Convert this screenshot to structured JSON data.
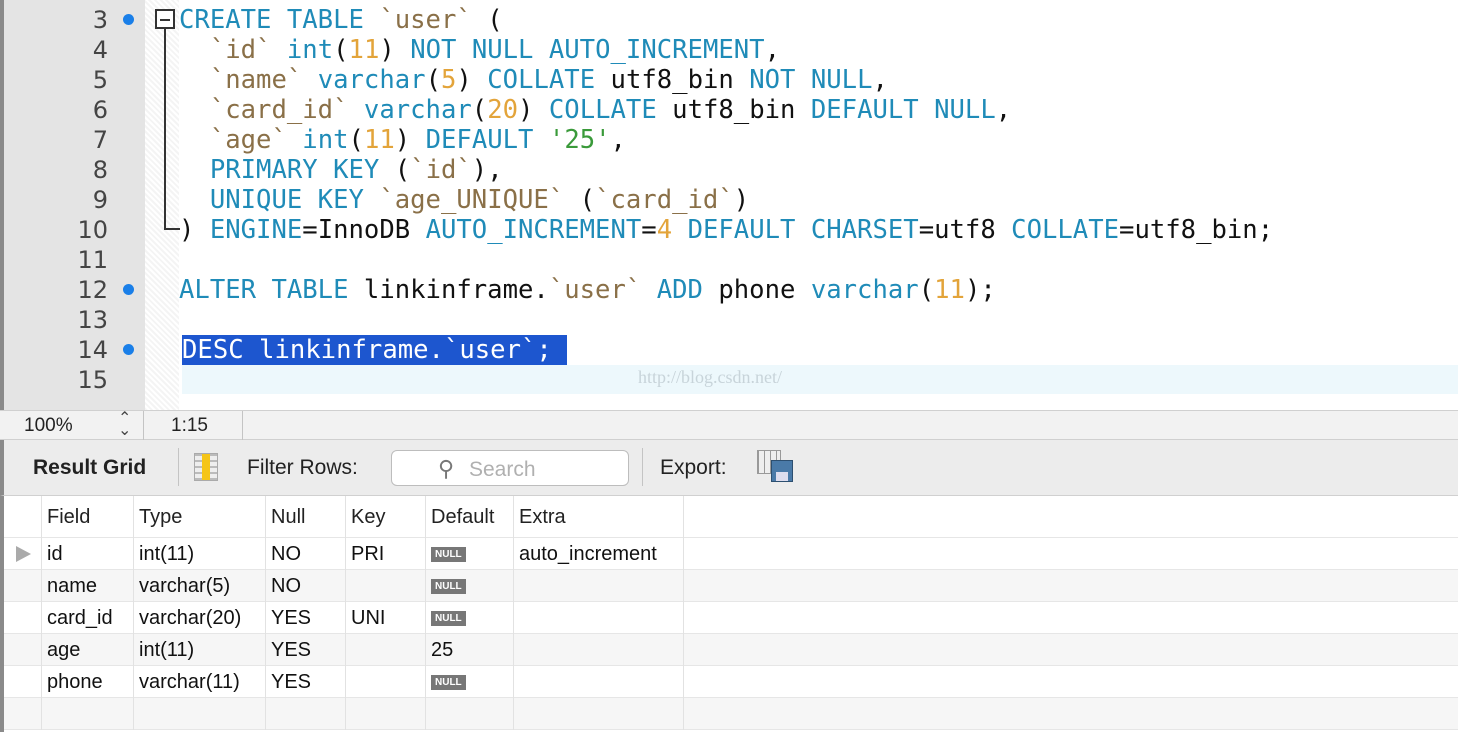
{
  "editor": {
    "lines": [
      {
        "n": "3",
        "dot": true,
        "tokens": [
          [
            "kw",
            "CREATE TABLE "
          ],
          [
            "id",
            "`user`"
          ],
          [
            "pl",
            " ("
          ]
        ]
      },
      {
        "n": "4",
        "dot": false,
        "tokens": [
          [
            "id",
            "  `id`"
          ],
          [
            "pl",
            " "
          ],
          [
            "kw",
            "int"
          ],
          [
            "pl",
            "("
          ],
          [
            "num",
            "11"
          ],
          [
            "pl",
            ") "
          ],
          [
            "kw",
            "NOT NULL AUTO_INCREMENT"
          ],
          [
            "pl",
            ","
          ]
        ]
      },
      {
        "n": "5",
        "dot": false,
        "tokens": [
          [
            "id",
            "  `name`"
          ],
          [
            "pl",
            " "
          ],
          [
            "kw",
            "varchar"
          ],
          [
            "pl",
            "("
          ],
          [
            "num",
            "5"
          ],
          [
            "pl",
            ") "
          ],
          [
            "kw",
            "COLLATE"
          ],
          [
            "pl",
            " utf8_bin "
          ],
          [
            "kw",
            "NOT NULL"
          ],
          [
            "pl",
            ","
          ]
        ]
      },
      {
        "n": "6",
        "dot": false,
        "tokens": [
          [
            "id",
            "  `card_id`"
          ],
          [
            "pl",
            " "
          ],
          [
            "kw",
            "varchar"
          ],
          [
            "pl",
            "("
          ],
          [
            "num",
            "20"
          ],
          [
            "pl",
            ") "
          ],
          [
            "kw",
            "COLLATE"
          ],
          [
            "pl",
            " utf8_bin "
          ],
          [
            "kw",
            "DEFAULT NULL"
          ],
          [
            "pl",
            ","
          ]
        ]
      },
      {
        "n": "7",
        "dot": false,
        "tokens": [
          [
            "id",
            "  `age`"
          ],
          [
            "pl",
            " "
          ],
          [
            "kw",
            "int"
          ],
          [
            "pl",
            "("
          ],
          [
            "num",
            "11"
          ],
          [
            "pl",
            ") "
          ],
          [
            "kw",
            "DEFAULT"
          ],
          [
            "pl",
            " "
          ],
          [
            "str",
            "'25'"
          ],
          [
            "pl",
            ","
          ]
        ]
      },
      {
        "n": "8",
        "dot": false,
        "tokens": [
          [
            "kw",
            "  PRIMARY KEY"
          ],
          [
            "pl",
            " ("
          ],
          [
            "id",
            "`id`"
          ],
          [
            "pl",
            "),"
          ]
        ]
      },
      {
        "n": "9",
        "dot": false,
        "tokens": [
          [
            "kw",
            "  UNIQUE KEY"
          ],
          [
            "pl",
            " "
          ],
          [
            "id",
            "`age_UNIQUE`"
          ],
          [
            "pl",
            " ("
          ],
          [
            "id",
            "`card_id`"
          ],
          [
            "pl",
            ")"
          ]
        ]
      },
      {
        "n": "10",
        "dot": false,
        "tokens": [
          [
            "pl",
            ") "
          ],
          [
            "kw",
            "ENGINE"
          ],
          [
            "pl",
            "=InnoDB "
          ],
          [
            "kw",
            "AUTO_INCREMENT"
          ],
          [
            "pl",
            "="
          ],
          [
            "num",
            "4"
          ],
          [
            "pl",
            " "
          ],
          [
            "kw",
            "DEFAULT CHARSET"
          ],
          [
            "pl",
            "=utf8 "
          ],
          [
            "kw",
            "COLLATE"
          ],
          [
            "pl",
            "=utf8_bin;"
          ]
        ]
      },
      {
        "n": "11",
        "dot": false,
        "tokens": []
      },
      {
        "n": "12",
        "dot": true,
        "tokens": [
          [
            "kw",
            "ALTER TABLE"
          ],
          [
            "pl",
            " linkinframe."
          ],
          [
            "id",
            "`user`"
          ],
          [
            "pl",
            " "
          ],
          [
            "kw",
            "ADD"
          ],
          [
            "pl",
            " phone "
          ],
          [
            "kw",
            "varchar"
          ],
          [
            "pl",
            "("
          ],
          [
            "num",
            "11"
          ],
          [
            "pl",
            ");"
          ]
        ]
      },
      {
        "n": "13",
        "dot": false,
        "tokens": []
      },
      {
        "n": "14",
        "dot": true,
        "selected": true,
        "tokens": [
          [
            "kw",
            "DESC linkinframe.`user`; "
          ]
        ]
      },
      {
        "n": "15",
        "dot": false,
        "tokens": []
      }
    ],
    "watermark": "http://blog.csdn.net/"
  },
  "status": {
    "zoom": "100%",
    "cursor": "1:15"
  },
  "toolbar": {
    "result_grid": "Result Grid",
    "filter_label": "Filter Rows:",
    "search_placeholder": "Search",
    "export_label": "Export:"
  },
  "grid": {
    "columns": [
      "Field",
      "Type",
      "Null",
      "Key",
      "Default",
      "Extra"
    ],
    "rows": [
      [
        "id",
        "int(11)",
        "NO",
        "PRI",
        "NULL",
        "auto_increment"
      ],
      [
        "name",
        "varchar(5)",
        "NO",
        "",
        "NULL",
        ""
      ],
      [
        "card_id",
        "varchar(20)",
        "YES",
        "UNI",
        "NULL",
        ""
      ],
      [
        "age",
        "int(11)",
        "YES",
        "",
        "25",
        ""
      ],
      [
        "phone",
        "varchar(11)",
        "YES",
        "",
        "NULL",
        ""
      ]
    ]
  },
  "colors": {
    "keyword": "#1f8bb8",
    "identifier": "#8a7048",
    "number": "#e3a43a",
    "string": "#3a9a3a",
    "selection": "#1d56cf"
  }
}
